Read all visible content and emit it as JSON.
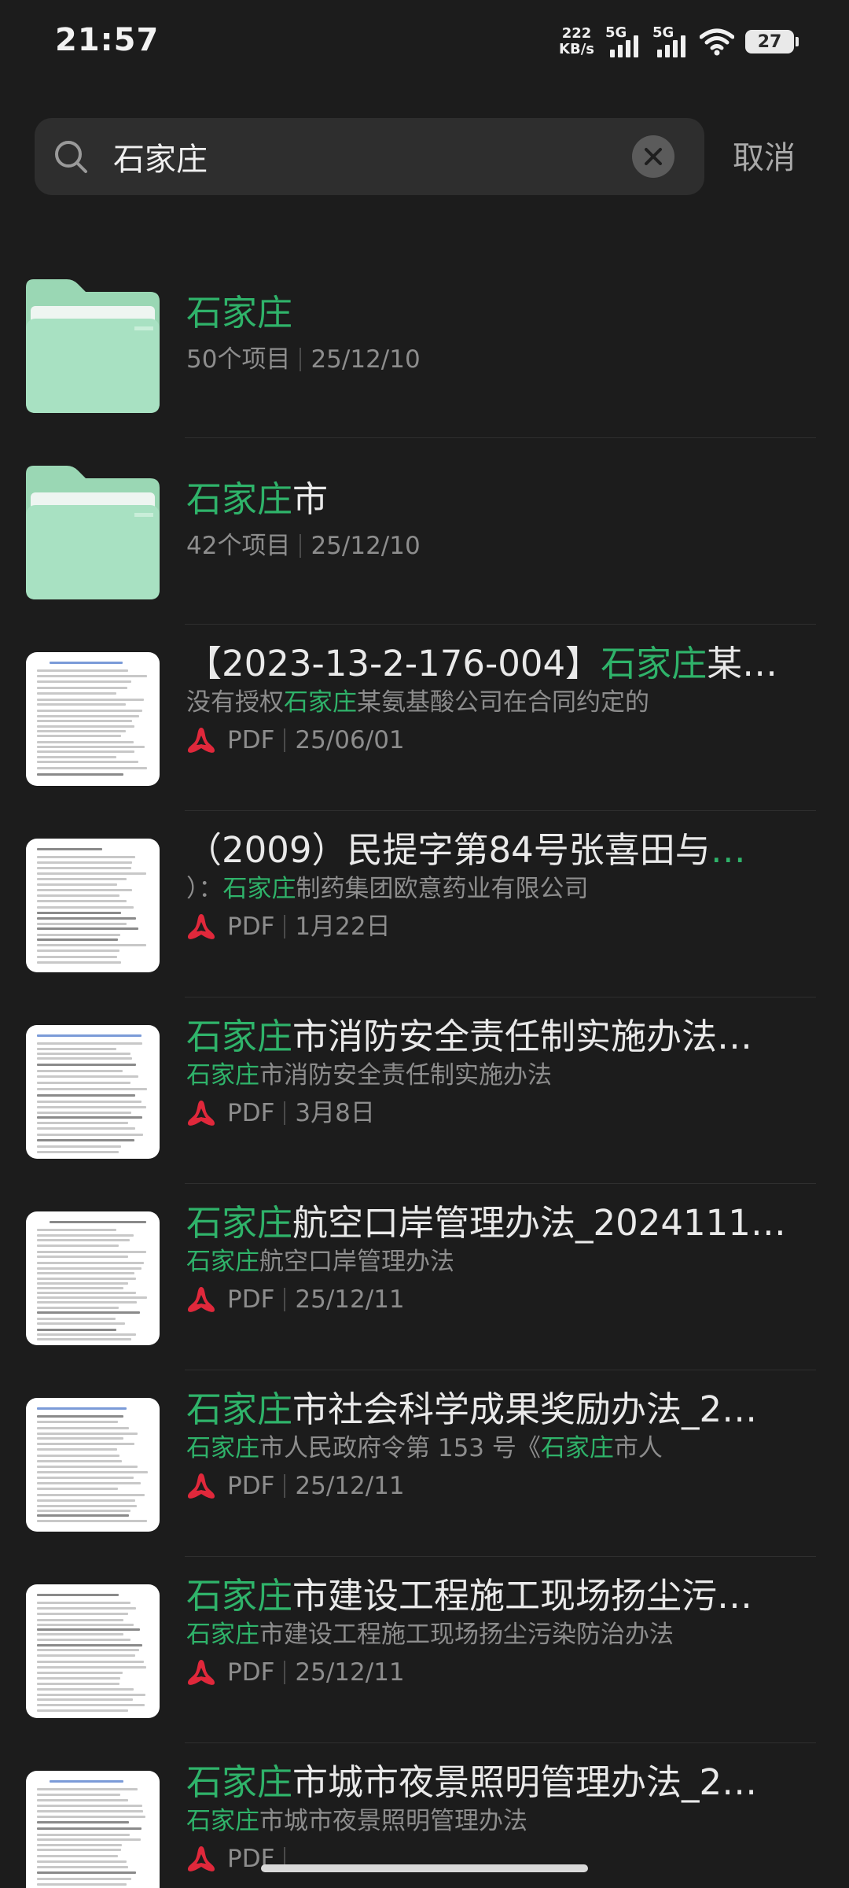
{
  "status_bar": {
    "time": "21:57",
    "net_speed_value": "222",
    "net_speed_unit": "KB/s",
    "sim1_label": "5G",
    "sim2_label": "5G",
    "battery": "27"
  },
  "search": {
    "query": "石家庄",
    "placeholder": "",
    "cancel_label": "取消"
  },
  "colors": {
    "background": "#1c1c1c",
    "highlight": "#2fb36a",
    "folder": "#a8e1c2",
    "pdf_red": "#e0283b"
  },
  "folders": [
    {
      "title_hl": "石家庄",
      "title_rest": "",
      "count": "50个项目",
      "date": "25/12/10"
    },
    {
      "title_hl": "石家庄",
      "title_rest": "市",
      "count": "42个项目",
      "date": "25/12/10"
    }
  ],
  "files": [
    {
      "title_pre": "【2023-13-2-176-004】",
      "title_hl": "石家庄",
      "title_post": "某…",
      "sub_pre": "没有授权",
      "sub_hl": "石家庄",
      "sub_post": "某氨基酸公司在合同约定的",
      "sub_hl2": "",
      "sub_post2": "",
      "type": "PDF",
      "date": "25/06/01"
    },
    {
      "title_pre": "（2009）民提字第84号张喜田与",
      "title_hl": "…",
      "title_post": "",
      "sub_pre": "）：",
      "sub_hl": "石家庄",
      "sub_post": "制药集团欧意药业有限公司",
      "sub_hl2": "",
      "sub_post2": "",
      "type": "PDF",
      "date": "1月22日"
    },
    {
      "title_pre": "",
      "title_hl": "石家庄",
      "title_post": "市消防安全责任制实施办法…",
      "sub_pre": "",
      "sub_hl": "石家庄",
      "sub_post": "市消防安全责任制实施办法",
      "sub_hl2": "",
      "sub_post2": "",
      "type": "PDF",
      "date": "3月8日"
    },
    {
      "title_pre": "",
      "title_hl": "石家庄",
      "title_post": "航空口岸管理办法_2024111…",
      "sub_pre": "",
      "sub_hl": "石家庄",
      "sub_post": "航空口岸管理办法",
      "sub_hl2": "",
      "sub_post2": "",
      "type": "PDF",
      "date": "25/12/11"
    },
    {
      "title_pre": "",
      "title_hl": "石家庄",
      "title_post": "市社会科学成果奖励办法_2…",
      "sub_pre": "",
      "sub_hl": "石家庄",
      "sub_post": "市人民政府令第 153 号《",
      "sub_hl2": "石家庄",
      "sub_post2": "市人",
      "type": "PDF",
      "date": "25/12/11"
    },
    {
      "title_pre": "",
      "title_hl": "石家庄",
      "title_post": "市建设工程施工现场扬尘污…",
      "sub_pre": "",
      "sub_hl": "石家庄",
      "sub_post": "市建设工程施工现场扬尘污染防治办法",
      "sub_hl2": "",
      "sub_post2": "",
      "type": "PDF",
      "date": "25/12/11"
    },
    {
      "title_pre": "",
      "title_hl": "石家庄",
      "title_post": "市城市夜景照明管理办法_2…",
      "sub_pre": "",
      "sub_hl": "石家庄",
      "sub_post": "市城市夜景照明管理办法",
      "sub_hl2": "",
      "sub_post2": "",
      "type": "PDF",
      "date": ""
    }
  ]
}
